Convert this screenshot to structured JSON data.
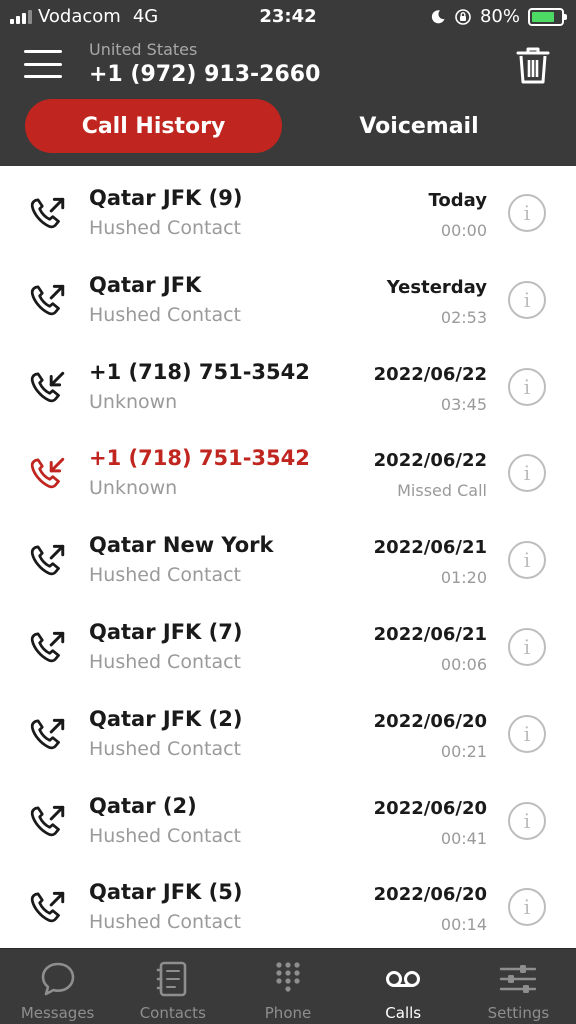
{
  "status_bar": {
    "carrier": "Vodacom",
    "network": "4G",
    "time": "23:42",
    "battery": "80%",
    "battery_level": 0.8
  },
  "header": {
    "country": "United States",
    "number": "+1 (972) 913-2660"
  },
  "tabs": {
    "call_history": "Call History",
    "voicemail": "Voicemail"
  },
  "calls": [
    {
      "name": "Qatar JFK (9)",
      "sub": "Hushed Contact",
      "date": "Today",
      "detail": "00:00",
      "direction": "outgoing",
      "missed": false
    },
    {
      "name": "Qatar JFK",
      "sub": "Hushed Contact",
      "date": "Yesterday",
      "detail": "02:53",
      "direction": "outgoing",
      "missed": false
    },
    {
      "name": "+1 (718) 751-3542",
      "sub": "Unknown",
      "date": "2022/06/22",
      "detail": "03:45",
      "direction": "incoming",
      "missed": false
    },
    {
      "name": "+1 (718) 751-3542",
      "sub": "Unknown",
      "date": "2022/06/22",
      "detail": "Missed Call",
      "direction": "incoming",
      "missed": true
    },
    {
      "name": "Qatar New York",
      "sub": "Hushed Contact",
      "date": "2022/06/21",
      "detail": "01:20",
      "direction": "outgoing",
      "missed": false
    },
    {
      "name": "Qatar JFK (7)",
      "sub": "Hushed Contact",
      "date": "2022/06/21",
      "detail": "00:06",
      "direction": "outgoing",
      "missed": false
    },
    {
      "name": "Qatar JFK (2)",
      "sub": "Hushed Contact",
      "date": "2022/06/20",
      "detail": "00:21",
      "direction": "outgoing",
      "missed": false
    },
    {
      "name": "Qatar (2)",
      "sub": "Hushed Contact",
      "date": "2022/06/20",
      "detail": "00:41",
      "direction": "outgoing",
      "missed": false
    },
    {
      "name": "Qatar JFK (5)",
      "sub": "Hushed Contact",
      "date": "2022/06/20",
      "detail": "00:14",
      "direction": "outgoing",
      "missed": false
    }
  ],
  "bottom_nav": {
    "messages": "Messages",
    "contacts": "Contacts",
    "phone": "Phone",
    "calls": "Calls",
    "settings": "Settings"
  },
  "colors": {
    "accent": "#c0261f",
    "header_bg": "#3a3a3a",
    "text_dark": "#1a1a1a",
    "text_muted": "#9a9a9a"
  }
}
